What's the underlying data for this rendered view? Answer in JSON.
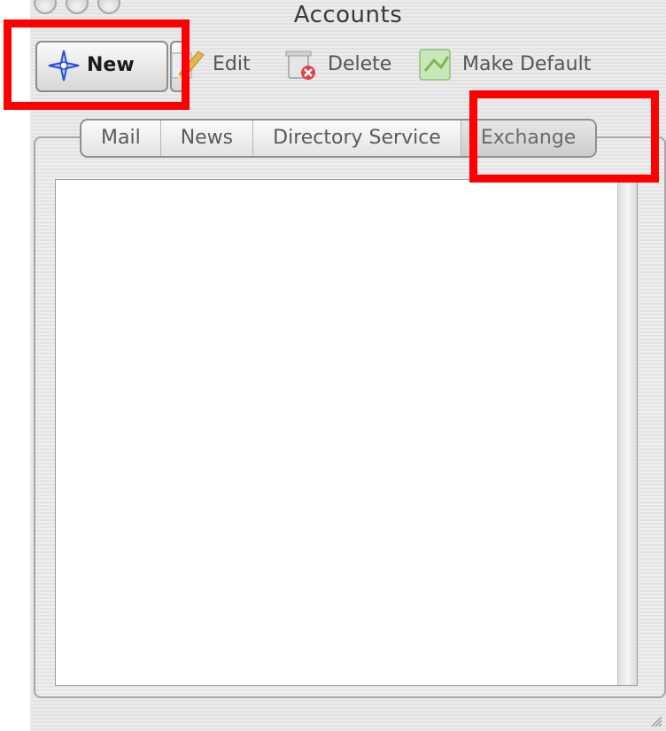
{
  "window": {
    "title": "Accounts"
  },
  "toolbar": {
    "new_label": "New",
    "edit_label": "Edit",
    "delete_label": "Delete",
    "make_default_label": "Make Default"
  },
  "tabs": [
    {
      "label": "Mail"
    },
    {
      "label": "News"
    },
    {
      "label": "Directory Service"
    },
    {
      "label": "Exchange",
      "selected": true
    }
  ],
  "icons": {
    "new": "new-star-icon",
    "dropdown": "dropdown-arrow-icon",
    "edit": "edit-pencil-icon",
    "delete": "trash-icon",
    "make_default": "make-default-icon",
    "resize": "resize-grip-icon"
  },
  "annotations": {
    "highlight_color": "#ff0000"
  }
}
